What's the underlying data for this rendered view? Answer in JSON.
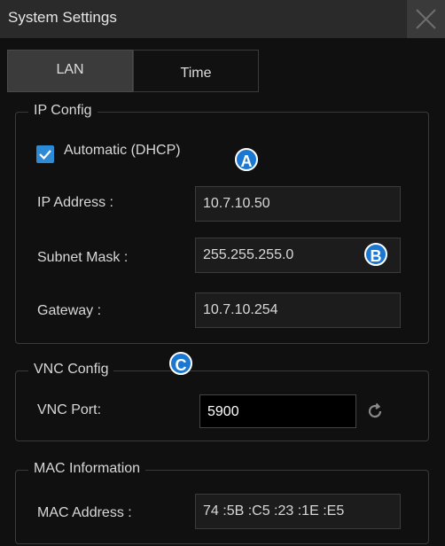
{
  "window": {
    "title": "System Settings",
    "close_icon": "close-icon"
  },
  "tabs": [
    {
      "label": "LAN",
      "active": true
    },
    {
      "label": "Time",
      "active": false
    }
  ],
  "ip_config": {
    "legend": "IP Config",
    "dhcp": {
      "label": "Automatic (DHCP)",
      "checked": true
    },
    "ip_address": {
      "label": "IP Address :",
      "value": "10.7.10.50"
    },
    "subnet_mask": {
      "label": "Subnet Mask :",
      "value": "255.255.255.0"
    },
    "gateway": {
      "label": "Gateway :",
      "value": "10.7.10.254"
    }
  },
  "vnc_config": {
    "legend": "VNC Config",
    "port": {
      "label": "VNC Port:",
      "value": "5900"
    },
    "refresh_icon": "refresh-icon"
  },
  "mac_information": {
    "legend": "MAC Information",
    "mac_address": {
      "label": "MAC Address :",
      "value": "74 :5B :C5 :23 :1E :E5"
    }
  },
  "callouts": {
    "a": "A",
    "b": "B",
    "c": "C"
  },
  "colors": {
    "accent": "#2f8ad6",
    "callout": "#1a77d2",
    "background": "#101010"
  }
}
